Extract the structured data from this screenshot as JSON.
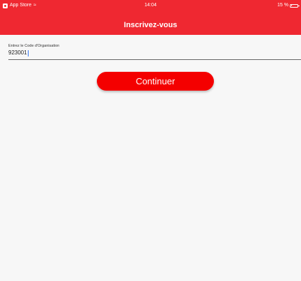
{
  "status_bar": {
    "carrier": "App Store",
    "time": "14:04",
    "battery_text": "15 %",
    "battery_level": 0.15,
    "icons": [
      "appstore-icon",
      "wifi-icon",
      "battery-icon"
    ]
  },
  "header": {
    "title": "Inscrivez-vous",
    "background_color": "#ef2831"
  },
  "form": {
    "org_code": {
      "label": "Entrez le Code d'Organisation",
      "value": "923001"
    },
    "continue_label": "Continuer",
    "button_color": "#f40000"
  }
}
